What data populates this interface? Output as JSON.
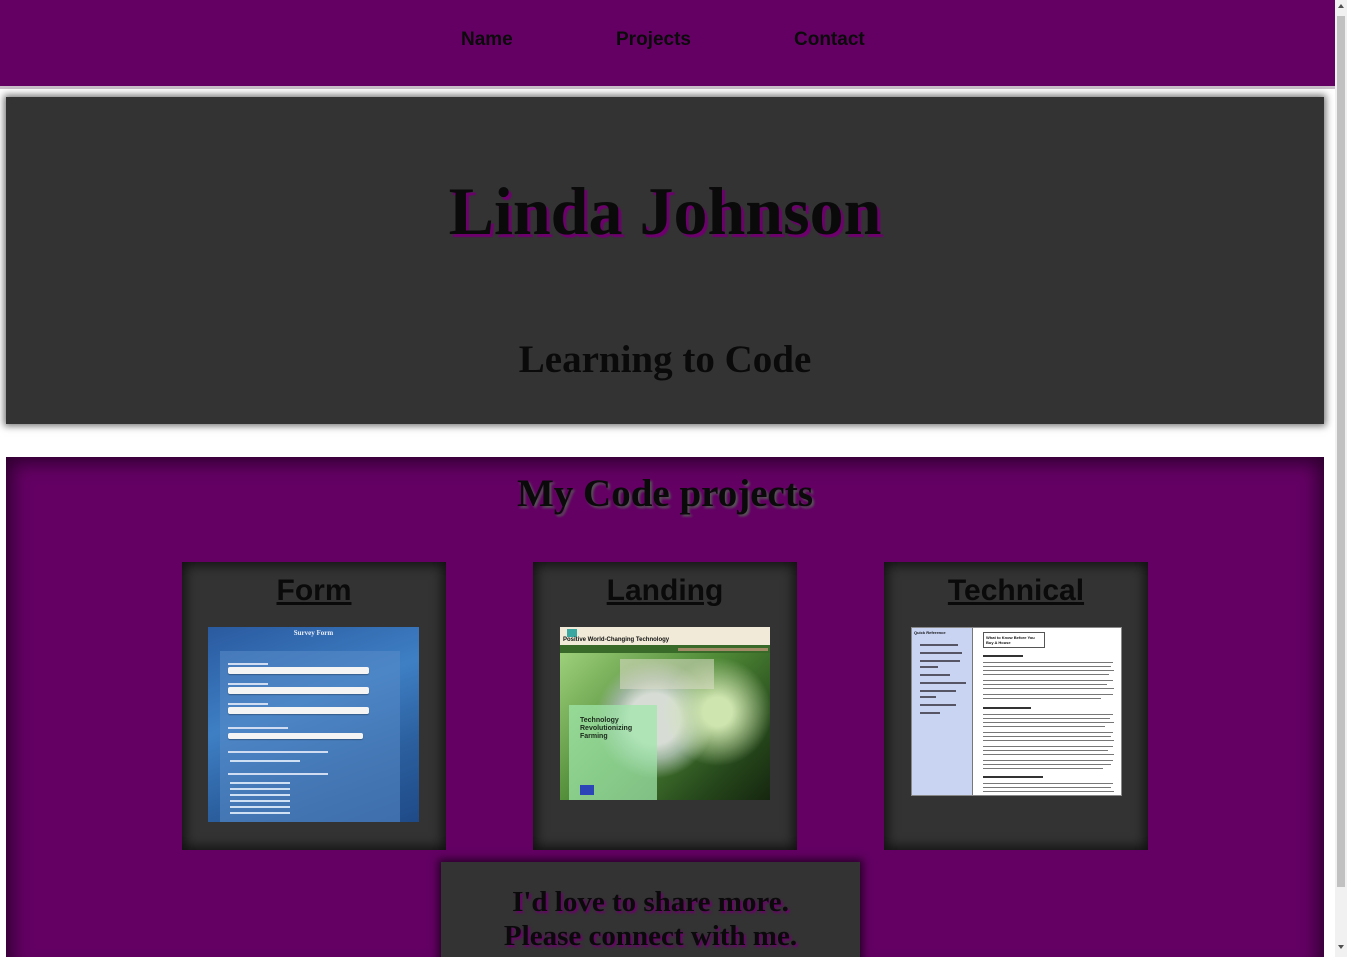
{
  "nav": {
    "links": [
      "Name",
      "Projects",
      "Contact"
    ]
  },
  "hero": {
    "name": "Linda Johnson",
    "tagline": "Learning to Code"
  },
  "projects": {
    "heading": "My Code projects",
    "cards": [
      {
        "title": "Form",
        "thumb_heading": "Survey Form"
      },
      {
        "title": "Landing",
        "thumb_heading": "Positive World-Changing Technology",
        "thumb_box_text": "Technology Revolutionizing Farming"
      },
      {
        "title": "Technical",
        "thumb_sidebar": "Quick Reference",
        "thumb_heading": "What to Know Before You Buy A House"
      }
    ]
  },
  "contact": {
    "line1": "I'd love to share more.",
    "line2": "Please connect with me."
  },
  "colors": {
    "nav_bg": "#640064",
    "panel_bg": "#333333",
    "projects_bg": "#640064",
    "text_shadow": "#6e006e"
  }
}
